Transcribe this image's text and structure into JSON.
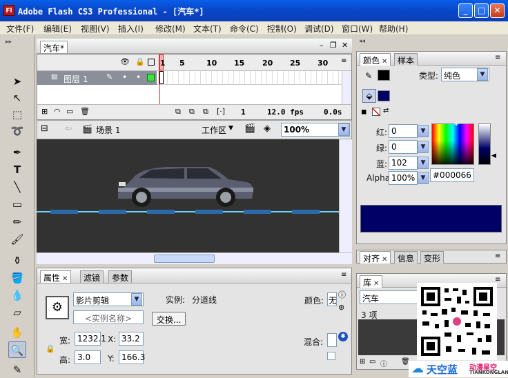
{
  "window": {
    "title": "Adobe Flash CS3 Professional - [汽车*]",
    "app_icon": "Fl"
  },
  "menu": [
    "文件(F)",
    "编辑(E)",
    "视图(V)",
    "插入(I)",
    "修改(M)",
    "文本(T)",
    "命令(C)",
    "控制(O)",
    "调试(D)",
    "窗口(W)",
    "帮助(H)"
  ],
  "document_tab": "汽车*",
  "timeline": {
    "layer_name": "图层 1",
    "frame_numbers": [
      "1",
      "5",
      "10",
      "15",
      "20",
      "25",
      "30"
    ],
    "current_frame": "1",
    "fps": "12.0 fps",
    "time": "0.0s"
  },
  "editbar": {
    "scene": "场景 1",
    "workspace": "工作区",
    "zoom": "100%"
  },
  "properties": {
    "tabs": [
      "属性",
      "滤镜",
      "参数"
    ],
    "symbol_type": "影片剪辑",
    "instance_label": "实例:",
    "instance_value": "分道线",
    "instance_name_placeholder": "<实例名称>",
    "swap_button": "交换...",
    "color_label": "颜色:",
    "color_value": "无",
    "blend_label": "混合:",
    "w_label": "宽:",
    "w_value": "1232.1",
    "h_label": "高:",
    "h_value": "3.0",
    "x_label": "X:",
    "x_value": "33.2",
    "y_label": "Y:",
    "y_value": "166.3"
  },
  "color_panel": {
    "tabs": [
      "颜色",
      "样本"
    ],
    "type_label": "类型:",
    "type_value": "纯色",
    "red_label": "红:",
    "red_value": "0",
    "green_label": "绿:",
    "green_value": "0",
    "blue_label": "蓝:",
    "blue_value": "102",
    "alpha_label": "Alpha:",
    "alpha_value": "100%",
    "hex_value": "#000066",
    "fill_color": "#000066"
  },
  "align_panel": {
    "tabs": [
      "对齐",
      "信息",
      "变形"
    ]
  },
  "library_panel": {
    "tab": "库",
    "selected_doc": "汽车",
    "count": "3 项"
  },
  "watermark": {
    "brand": "天空蓝",
    "sub1": "动漫星空",
    "sub2": "TIANKONGLAN"
  }
}
